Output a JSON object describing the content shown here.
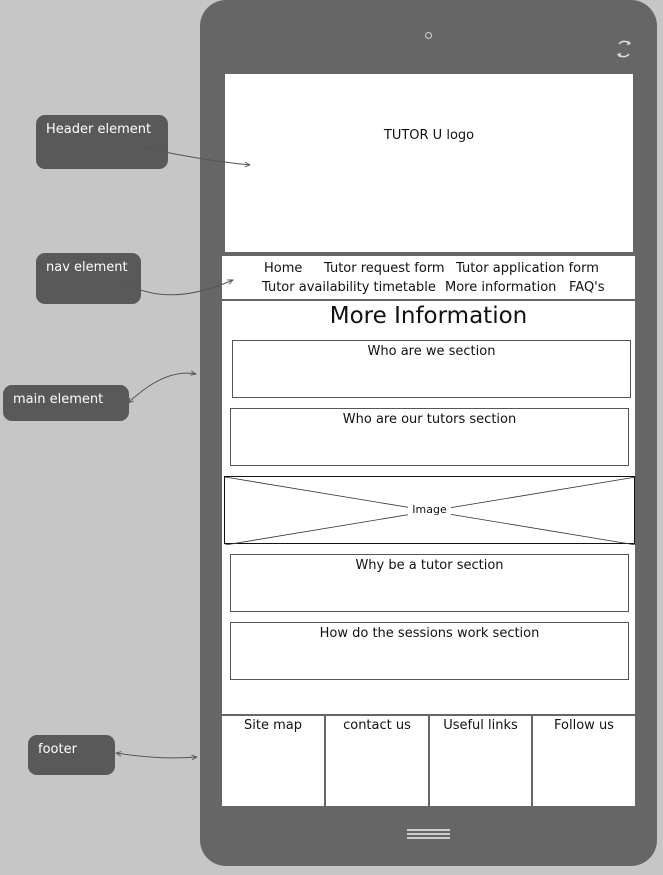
{
  "header": {
    "logo_text": "TUTOR U logo"
  },
  "nav": {
    "items": [
      "Home",
      "Tutor request form",
      "Tutor application form",
      "Tutor availability timetable",
      "More information",
      "FAQ's"
    ]
  },
  "main": {
    "title": "More Information",
    "sections": [
      "Who are we section",
      "Who are our tutors section",
      "Why be a tutor section",
      "How do the sessions work section"
    ],
    "image_label": "Image"
  },
  "footer": {
    "columns": [
      "Site map",
      "contact us",
      "Useful links",
      "Follow us"
    ]
  },
  "annotations": {
    "header": "Header element",
    "nav": "nav element",
    "main": "main element",
    "footer": "footer"
  },
  "icons": {
    "camera": "camera-icon",
    "rotate": "rotate-icon",
    "home": "home-button-icon"
  },
  "colors": {
    "background": "#c6c6c6",
    "phone_body": "#666666",
    "callout": "#595959",
    "screen": "#ffffff"
  }
}
